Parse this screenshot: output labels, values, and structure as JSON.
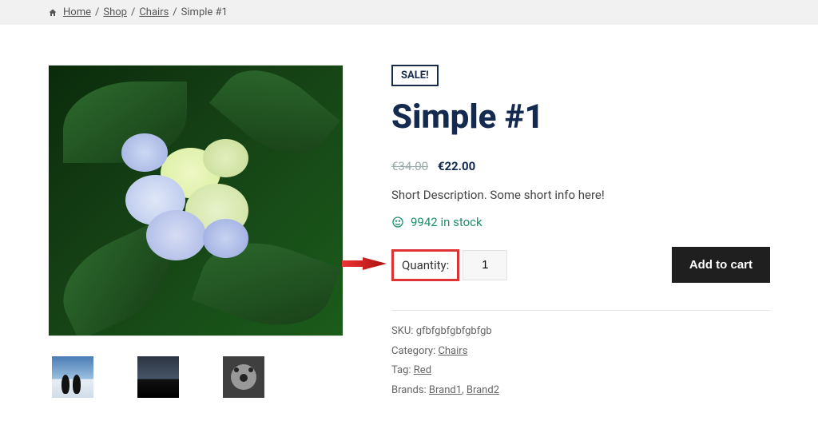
{
  "breadcrumb": {
    "home": "Home",
    "shop": "Shop",
    "category": "Chairs",
    "current": "Simple #1"
  },
  "product": {
    "sale_label": "SALE!",
    "title": "Simple #1",
    "price_old": "€34.00",
    "price_new": "€22.00",
    "short_description": "Short Description. Some short info here!",
    "stock_text": "9942 in stock",
    "quantity_label": "Quantity:",
    "quantity_value": "1",
    "add_to_cart": "Add to cart"
  },
  "meta": {
    "sku_label": "SKU: ",
    "sku_value": "gfbfgbfgbfgbfgb",
    "category_label": "Category: ",
    "category_value": "Chairs",
    "tag_label": "Tag: ",
    "tag_value": "Red",
    "brands_label": "Brands: ",
    "brand1": "Brand1",
    "brand_sep": ", ",
    "brand2": "Brand2"
  }
}
